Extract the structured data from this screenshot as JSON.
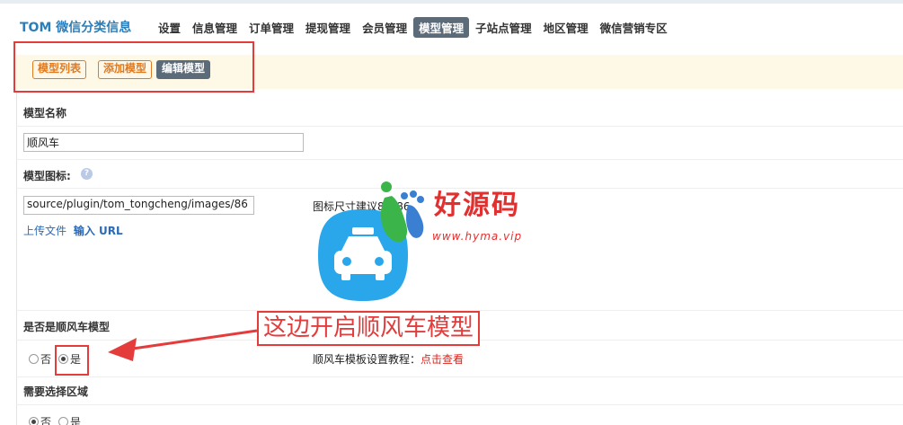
{
  "app": {
    "title": "TOM 微信分类信息"
  },
  "nav": {
    "items": [
      {
        "label": "设置",
        "active": false
      },
      {
        "label": "信息管理",
        "active": false
      },
      {
        "label": "订单管理",
        "active": false
      },
      {
        "label": "提现管理",
        "active": false
      },
      {
        "label": "会员管理",
        "active": false
      },
      {
        "label": "模型管理",
        "active": true
      },
      {
        "label": "子站点管理",
        "active": false
      },
      {
        "label": "地区管理",
        "active": false
      },
      {
        "label": "微信营销专区",
        "active": false
      }
    ]
  },
  "subtabs": [
    {
      "label": "模型列表",
      "active": false
    },
    {
      "label": "添加模型",
      "active": false
    },
    {
      "label": "编辑模型",
      "active": true
    }
  ],
  "form": {
    "name": {
      "label": "模型名称",
      "value": "顺风车"
    },
    "icon": {
      "label": "模型图标:",
      "value": "source/plugin/tom_tongcheng/images/86",
      "upload_label": "上传文件",
      "url_label": "输入 URL",
      "hint": "图标尺寸建议86*86",
      "icon_name": "car-icon",
      "icon_color": "#2aa7ea"
    },
    "is_carpool": {
      "label": "是否是顺风车模型",
      "options": [
        {
          "label": "否",
          "checked": false
        },
        {
          "label": "是",
          "checked": true
        }
      ],
      "tutorial_label": "顺风车模板设置教程：",
      "tutorial_link": "点击查看"
    },
    "need_area": {
      "label": "需要选择区域",
      "options": [
        {
          "label": "否",
          "checked": true
        },
        {
          "label": "是",
          "checked": false
        }
      ]
    }
  },
  "annotation": {
    "text": "这边开启顺风车模型",
    "color": "#e43b3b"
  },
  "watermark": {
    "title": "好源码",
    "url": "www.hyma.vip",
    "color": "#e13030"
  },
  "colors": {
    "brand": "#2a7fba",
    "nav_active": "#5c6b7a",
    "subtab": "#e07a1f",
    "link": "#2a6ab8"
  }
}
